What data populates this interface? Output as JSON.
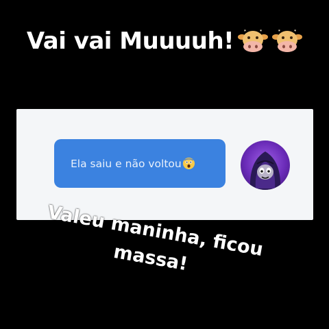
{
  "top_caption": {
    "text": "Vai vai Muuuuh!",
    "icons": [
      "cow-face-icon",
      "cow-face-icon"
    ]
  },
  "chat": {
    "message": {
      "text": "Ela saiu e não voltou",
      "emoji_icon": "astonished-face-icon"
    },
    "avatar_icon": "hooded-character-avatar"
  },
  "bottom_caption": {
    "line1": "Valeu maninha, ficou",
    "line2": "massa!"
  },
  "colors": {
    "background": "#000000",
    "panel": "#f4f6f8",
    "bubble": "#3b82e0",
    "avatar": "#7a35c8"
  }
}
